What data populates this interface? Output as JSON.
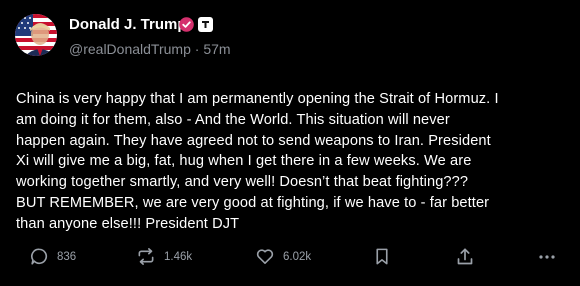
{
  "post": {
    "author": {
      "display_name": "Donald J. Trump",
      "handle": "@realDonaldTrump",
      "separator": "·",
      "time_ago": "57m",
      "verified_badge": "verified-check-icon",
      "affiliation_badge": "square-logo-icon"
    },
    "text": "China is very happy that I am permanently opening the Strait of Hormuz. I\nam doing it for them, also - And the World. This situation will never\nhappen again. They have agreed not to send weapons to Iran. President\nXi will give me a big, fat, hug when I get there in a few weeks. We are\nworking together smartly, and very well! Doesn’t that beat fighting???\nBUT REMEMBER, we are very good at fighting, if we have to - far better\nthan anyone else!!! President DJT",
    "actions": {
      "replies": {
        "icon": "reply-bubble-icon",
        "count": "836"
      },
      "reposts": {
        "icon": "repost-arrows-icon",
        "count": "1.46k"
      },
      "likes": {
        "icon": "heart-icon",
        "count": "6.02k"
      },
      "bookmark": {
        "icon": "bookmark-icon"
      },
      "share": {
        "icon": "share-upload-icon"
      },
      "more": {
        "icon": "more-dots-icon"
      }
    },
    "colors": {
      "background": "#000000",
      "text": "#ffffff",
      "muted": "#8b8f96",
      "verified_badge": "#d4306d"
    }
  }
}
